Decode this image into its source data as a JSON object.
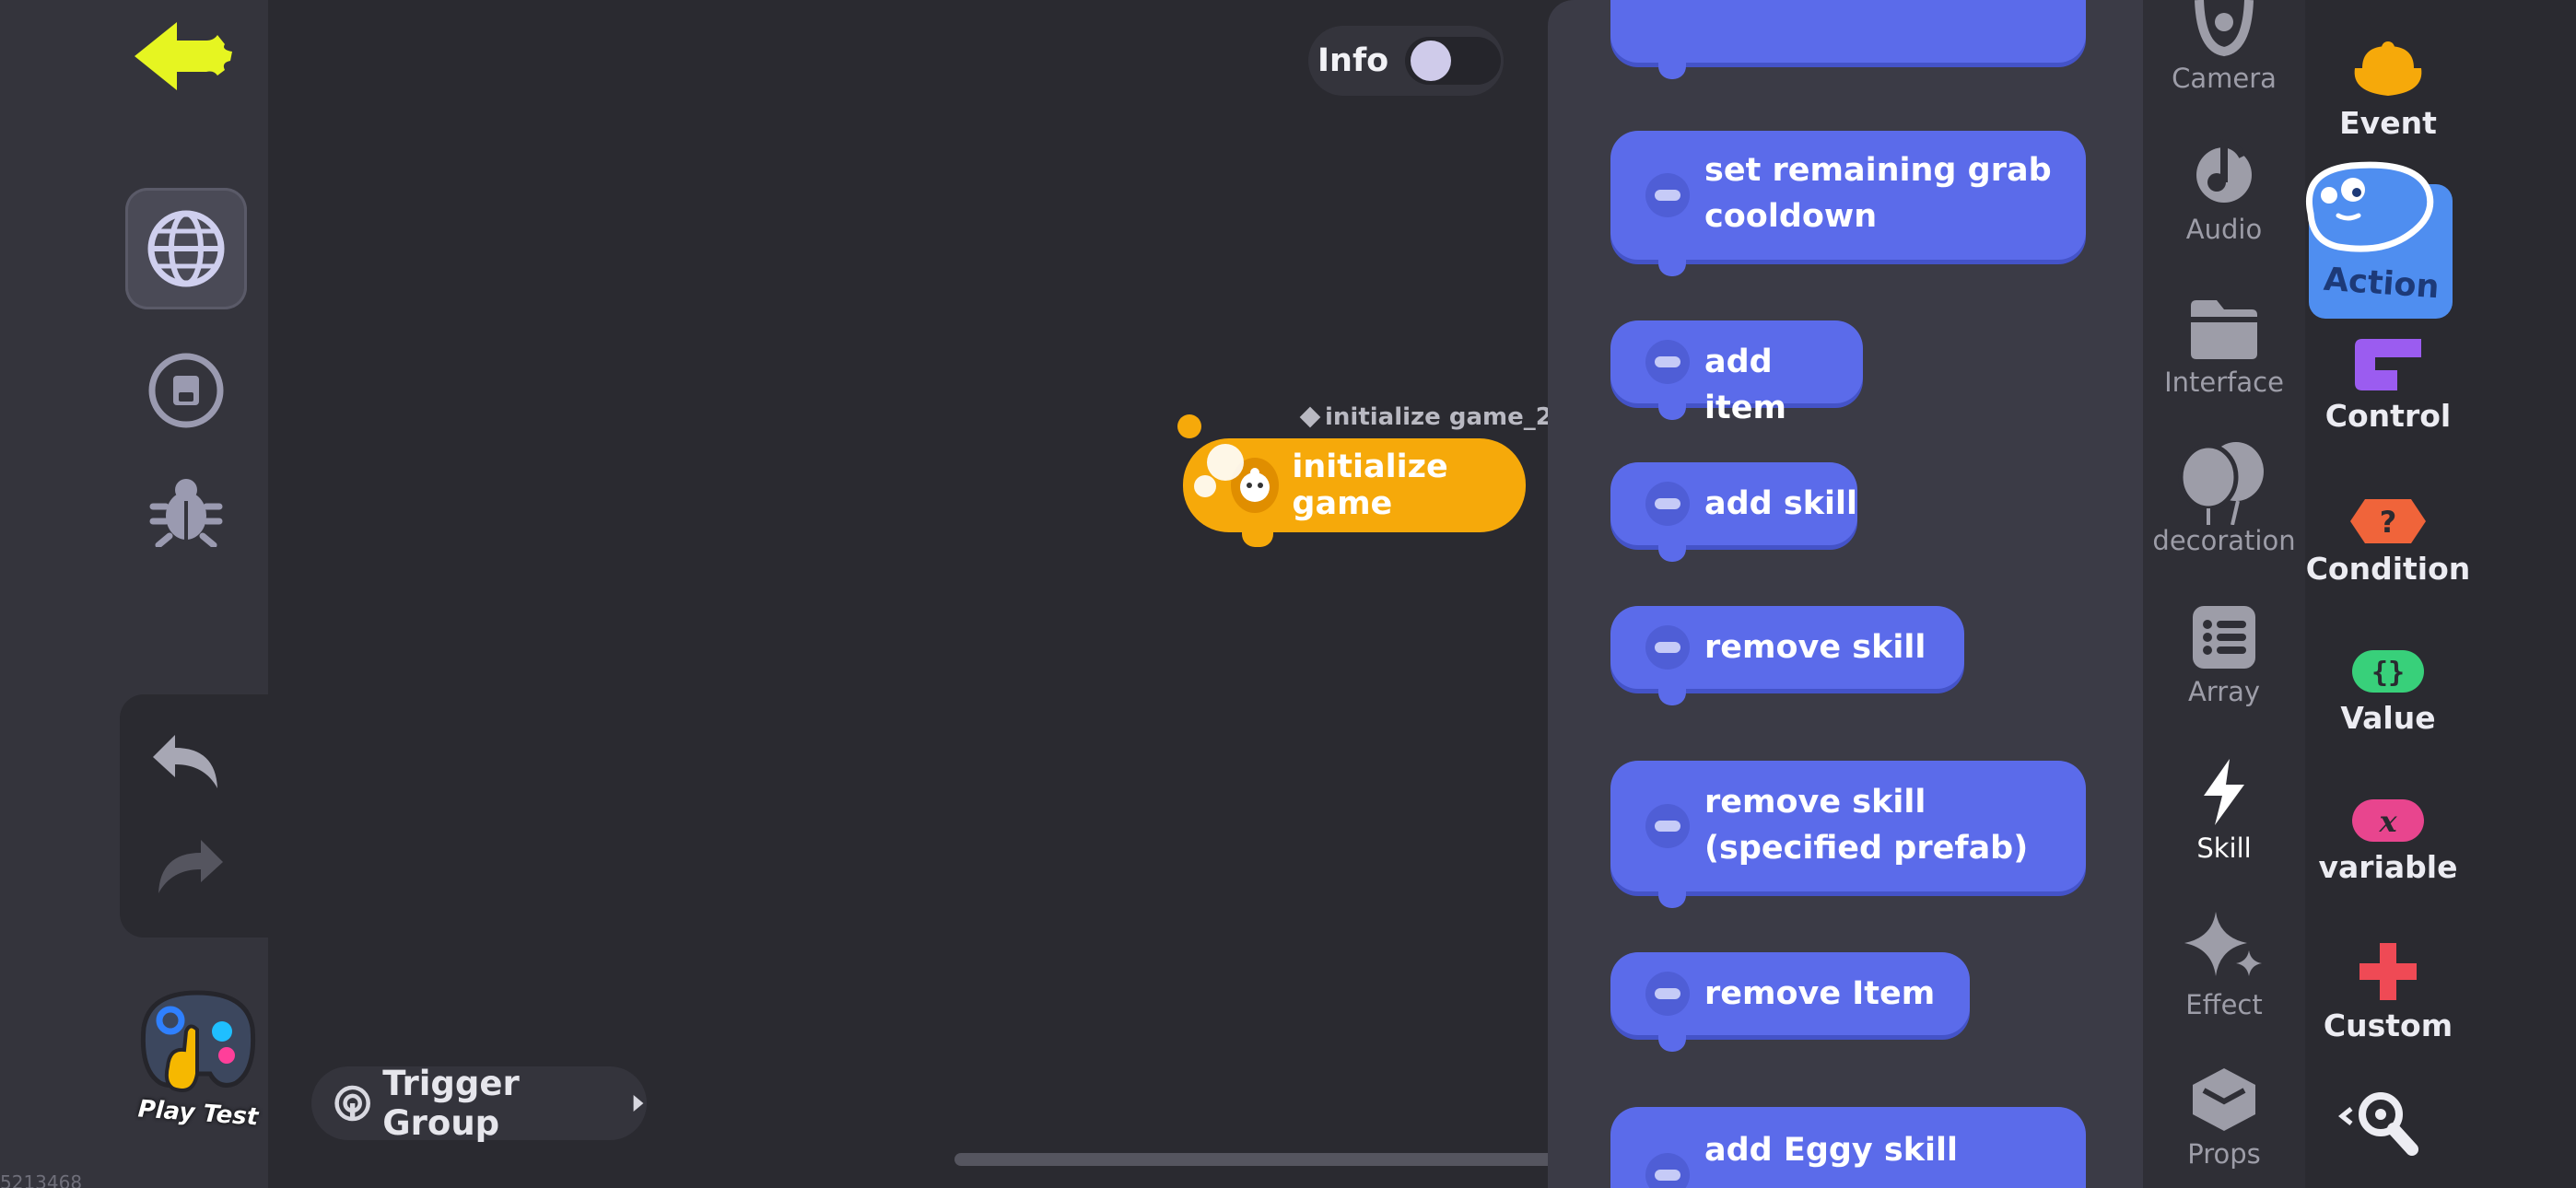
{
  "left_sidebar": {
    "icons": [
      "back-arrow-icon",
      "globe-icon",
      "save-icon",
      "bug-icon",
      "undo-icon",
      "redo-icon"
    ],
    "play_test_label": "Play Test",
    "corner_text": "5213468"
  },
  "info_toggle": {
    "label": "Info",
    "state": "off"
  },
  "canvas": {
    "event_block": {
      "name": "initialize game_2",
      "label": "initialize game"
    }
  },
  "trigger_group": {
    "label": "Trigger Group"
  },
  "palette": {
    "blocks": [
      {
        "label": "set remaining grab cooldown",
        "lines": [
          "set remaining grab",
          "cooldown"
        ]
      },
      {
        "label": "add item",
        "lines": [
          "add item"
        ]
      },
      {
        "label": "add skill",
        "lines": [
          "add skill"
        ]
      },
      {
        "label": "remove skill",
        "lines": [
          "remove skill"
        ]
      },
      {
        "label": "remove skill (specified prefab)",
        "lines": [
          "remove skill",
          "(specified prefab)"
        ]
      },
      {
        "label": "remove Item",
        "lines": [
          "remove Item"
        ]
      },
      {
        "label": "add Eggy skill",
        "lines": [
          "add Eggy skill"
        ]
      }
    ]
  },
  "subcategories": [
    {
      "label": "Camera",
      "icon": "camera-icon"
    },
    {
      "label": "Audio",
      "icon": "music-note-icon"
    },
    {
      "label": "Interface",
      "icon": "folder-icon"
    },
    {
      "label": "decoration",
      "icon": "balloons-icon"
    },
    {
      "label": "Array",
      "icon": "list-icon"
    },
    {
      "label": "Skill",
      "icon": "lightning-icon",
      "active": true
    },
    {
      "label": "Effect",
      "icon": "sparkle-icon"
    },
    {
      "label": "Props",
      "icon": "box-icon"
    }
  ],
  "categories": [
    {
      "label": "Event",
      "icon": "event-icon",
      "color": "#f6a90a"
    },
    {
      "label": "Action",
      "icon": "action-icon",
      "color": "#4f8ef0",
      "active": true
    },
    {
      "label": "Control",
      "icon": "control-icon",
      "color": "#9b5cf0"
    },
    {
      "label": "Condition",
      "icon": "condition-icon",
      "color": "#f0643a"
    },
    {
      "label": "Value",
      "icon": "value-icon",
      "color": "#38d07a"
    },
    {
      "label": "variable",
      "icon": "variable-icon",
      "color": "#e8458e"
    },
    {
      "label": "Custom",
      "icon": "plus-icon",
      "color": "#ef4a55"
    }
  ]
}
